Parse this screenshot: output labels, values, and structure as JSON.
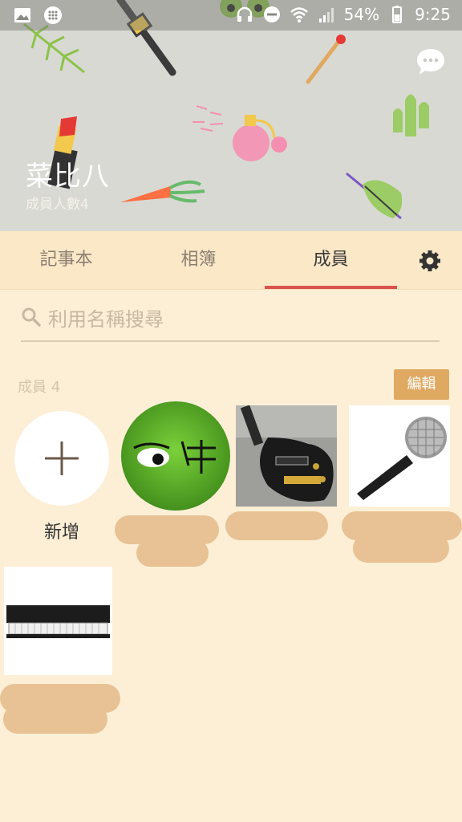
{
  "statusbar": {
    "battery": "54%",
    "time": "9:25"
  },
  "header": {
    "group_name": "菜比八",
    "member_count": "成員人數4"
  },
  "tabs": [
    {
      "label": "記事本"
    },
    {
      "label": "相簿"
    },
    {
      "label": "成員"
    }
  ],
  "search": {
    "placeholder": "利用名稱搜尋"
  },
  "members_section": {
    "label": "成員 4",
    "edit_label": "編輯",
    "add_label": "新增"
  },
  "colors": {
    "background": "#fcefd6",
    "tab_bar": "#fbe8c7",
    "active_tab_indicator": "#d9534f",
    "edit_button": "#e0a961"
  }
}
